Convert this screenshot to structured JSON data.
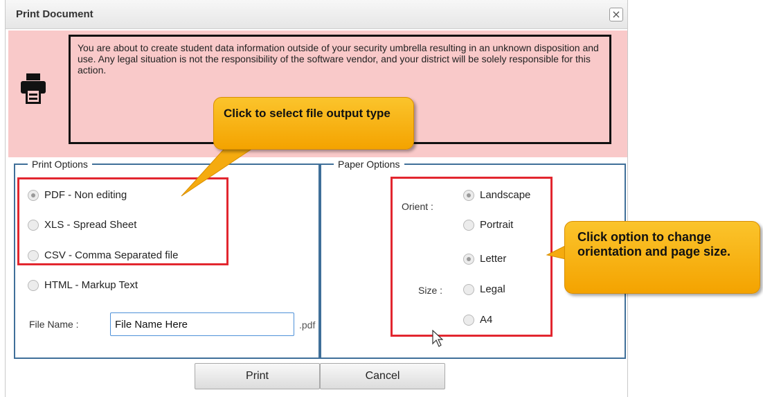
{
  "dialog": {
    "title": "Print Document",
    "close_symbol": "×",
    "warning_text": "You are about to create student data information outside of your security umbrella resulting in an unknown disposition and use. Any legal situation is not the responsibility of the software vendor, and your district will be solely responsible for this action.",
    "printer_icon": "printer-icon"
  },
  "print_options": {
    "legend": "Print Options",
    "options": [
      {
        "label": "PDF - Non editing",
        "selected": true
      },
      {
        "label": "XLS - Spread Sheet",
        "selected": false
      },
      {
        "label": "CSV - Comma Separated file",
        "selected": false
      },
      {
        "label": "HTML - Markup Text",
        "selected": false
      }
    ],
    "file_name_label": "File Name :",
    "file_name_value": "File Name Here",
    "extension": ".pdf"
  },
  "paper_options": {
    "legend": "Paper Options",
    "orient_label": "Orient :",
    "orient_options": [
      {
        "label": "Landscape",
        "selected": true
      },
      {
        "label": "Portrait",
        "selected": false
      }
    ],
    "size_label": "Size :",
    "size_options": [
      {
        "label": "Letter",
        "selected": true
      },
      {
        "label": "Legal",
        "selected": false
      },
      {
        "label": "A4",
        "selected": false
      }
    ]
  },
  "buttons": {
    "print": "Print",
    "cancel": "Cancel"
  },
  "annotations": {
    "callout_file_type": "Click to select file output type",
    "callout_orientation": "Click option to change orientation and page size.",
    "callout_color": "#f8b415",
    "highlight_color": "#e2262f"
  }
}
